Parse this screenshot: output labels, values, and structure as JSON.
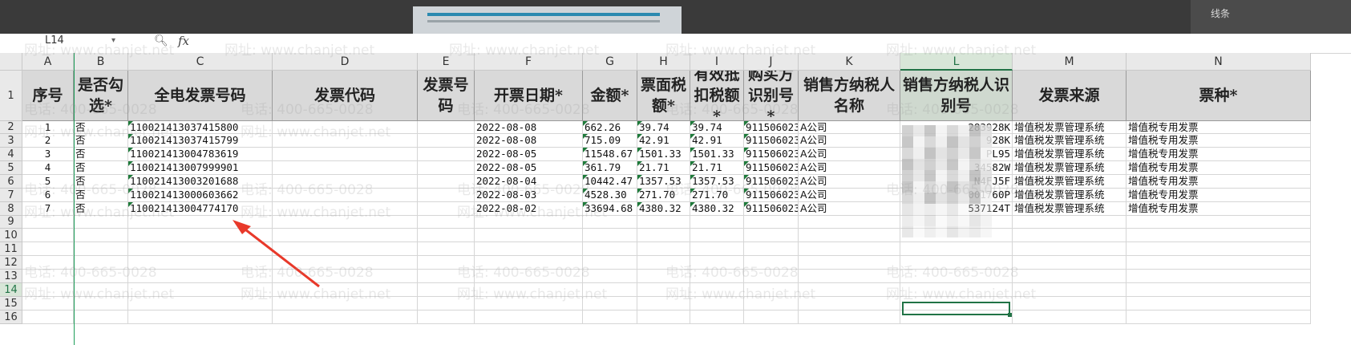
{
  "app": {
    "top_right_label": "线条",
    "name_box": "L14",
    "fx_label": "fx"
  },
  "columns": [
    "A",
    "B",
    "C",
    "D",
    "E",
    "F",
    "G",
    "H",
    "I",
    "J",
    "K",
    "L",
    "M",
    "N"
  ],
  "selected_column": "L",
  "rows": [
    "1",
    "2",
    "3",
    "4",
    "5",
    "6",
    "7",
    "8",
    "9",
    "10",
    "11",
    "12",
    "13",
    "14",
    "15",
    "16"
  ],
  "selected_row": "14",
  "header_labels": [
    "序号",
    "是否勾选*",
    "全电发票号码",
    "发票代码",
    "发票号码",
    "开票日期*",
    "金额*",
    "票面税额*",
    "有效抵扣税额*",
    "购买方识别号*",
    "销售方纳税人名称",
    "销售方纳税人识别号",
    "发票来源",
    "票种*"
  ],
  "table_rows": [
    [
      "1",
      "否",
      "110021413037415800",
      "",
      "",
      "2022-08-08",
      "662.26",
      "39.74",
      "39.74",
      "911506023",
      "A公司",
      "",
      "增值税发票管理系统",
      "增值税专用发票"
    ],
    [
      "2",
      "否",
      "110021413037415799",
      "",
      "",
      "2022-08-08",
      "715.09",
      "42.91",
      "42.91",
      "911506023",
      "A公司",
      "",
      "增值税发票管理系统",
      "增值税专用发票"
    ],
    [
      "3",
      "否",
      "110021413004783619",
      "",
      "",
      "2022-08-05",
      "11548.67",
      "1501.33",
      "1501.33",
      "911506023",
      "A公司",
      "",
      "增值税发票管理系统",
      "增值税专用发票"
    ],
    [
      "4",
      "否",
      "110021413007999901",
      "",
      "",
      "2022-08-05",
      "361.79",
      "21.71",
      "21.71",
      "911506023",
      "A公司",
      "",
      "增值税发票管理系统",
      "增值税专用发票"
    ],
    [
      "5",
      "否",
      "110021413003201688",
      "",
      "",
      "2022-08-04",
      "10442.47",
      "1357.53",
      "1357.53",
      "911506023",
      "A公司",
      "",
      "增值税发票管理系统",
      "增值税专用发票"
    ],
    [
      "6",
      "否",
      "110021413000603662",
      "",
      "",
      "2022-08-03",
      "4528.30",
      "271.70",
      "271.70",
      "911506023",
      "A公司",
      "",
      "增值税发票管理系统",
      "增值税专用发票"
    ],
    [
      "7",
      "否",
      "110021413004774170",
      "",
      "",
      "2022-08-02",
      "33694.68",
      "4380.32",
      "4380.32",
      "911506023",
      "A公司",
      "",
      "增值税发票管理系统",
      "增值税专用发票"
    ]
  ],
  "seller_id_visible_tails": [
    "283928K",
    "928K",
    "PL95",
    "34582W",
    "N4FJ5F",
    "001760P",
    "537124T"
  ],
  "watermark": {
    "url_text": "网址: www.chanjet.net",
    "phone_text": "电话: 400-665-0028"
  },
  "colors": {
    "accent": "#217346",
    "header_fill": "#d9d9d9",
    "arrow": "#e8392a"
  }
}
